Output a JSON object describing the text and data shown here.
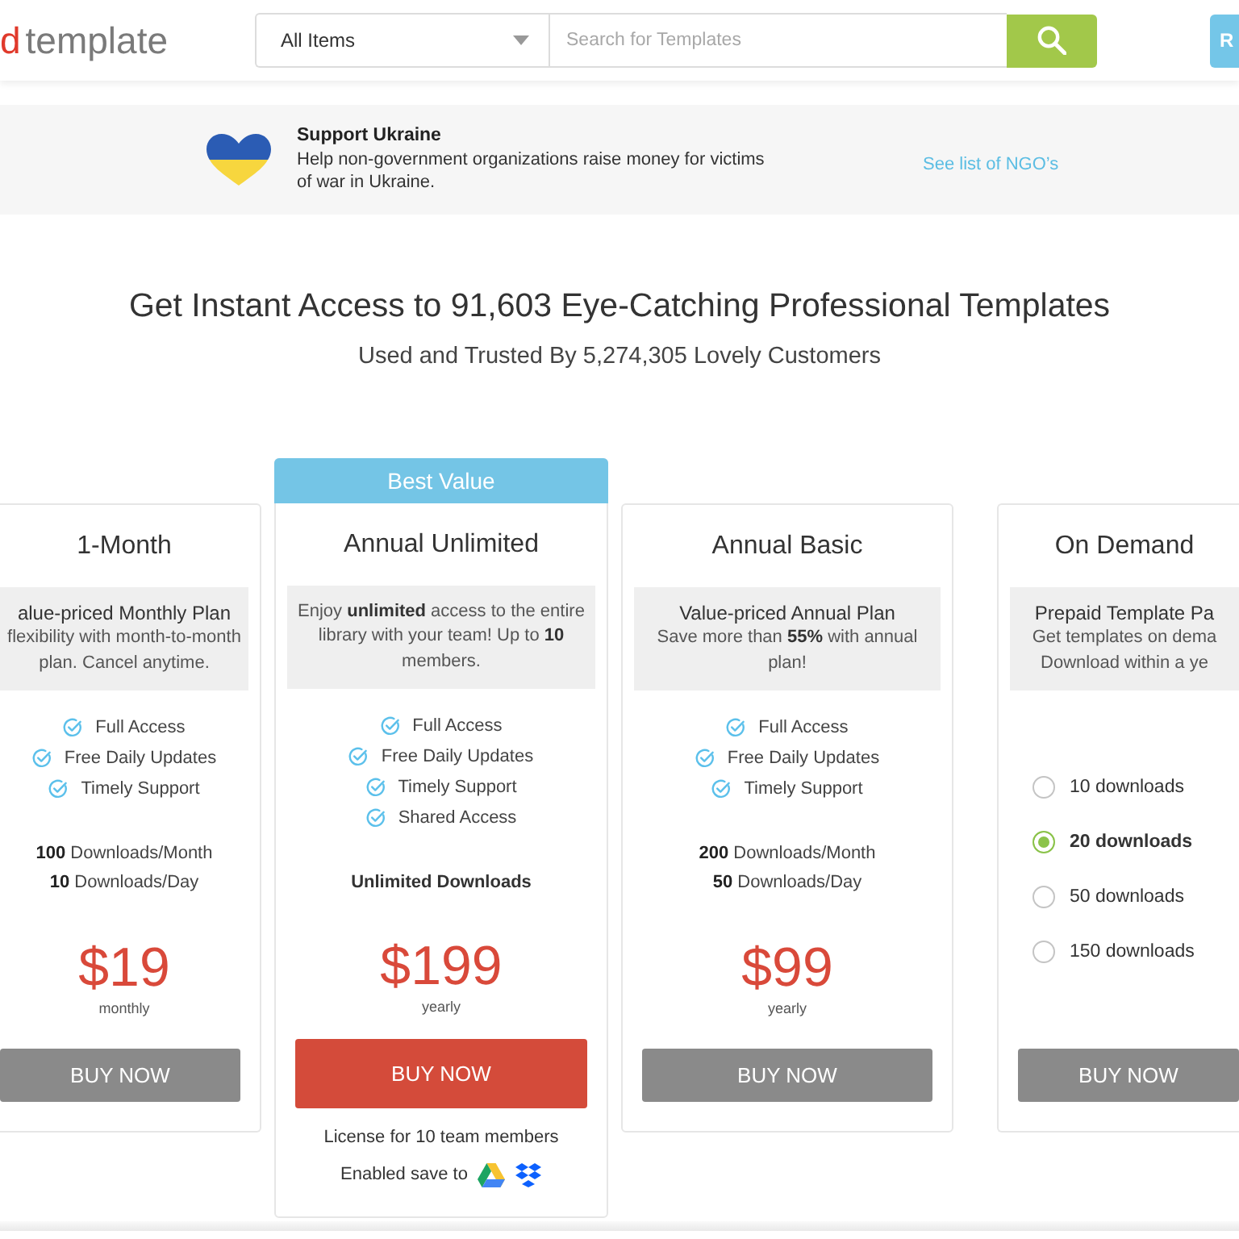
{
  "header": {
    "logo": {
      "mark": "d",
      "word": "template"
    },
    "search": {
      "category": "All Items",
      "placeholder": "Search for Templates"
    },
    "account_button": {
      "label": "R"
    }
  },
  "banner": {
    "title": "Support Ukraine",
    "text": "Help non-government organizations raise money for victims of war in Ukraine.",
    "link": "See list of NGO’s"
  },
  "hero": {
    "title": "Get Instant Access to 91,603 Eye-Catching Professional Templates",
    "subtitle": "Used and Trusted By 5,274,305 Lovely Customers"
  },
  "plans": [
    {
      "kind": "subscription",
      "name": "1-Month",
      "summary": "alue-priced Monthly Plan",
      "description": [
        "flexibility with month-to-month",
        "plan. Cancel anytime."
      ],
      "features": [
        "Full Access",
        "Free Daily Updates",
        "Timely Support"
      ],
      "downloads": [
        "**100** Downloads/Month",
        "**10** Downloads/Day"
      ],
      "price": "$19",
      "period": "monthly",
      "button": {
        "label": "BUY NOW",
        "primary": false
      }
    },
    {
      "kind": "subscription",
      "badge": "Best Value",
      "name": "Annual Unlimited",
      "description": [
        "Enjoy **unlimited** access to the entire library with your team! Up to **10** members."
      ],
      "features": [
        "Full Access",
        "Free Daily Updates",
        "Timely Support",
        "Shared Access"
      ],
      "downloads_total": "Unlimited Downloads",
      "price": "$199",
      "period": "yearly",
      "button": {
        "label": "BUY NOW",
        "primary": true
      },
      "license": "License for 10 team members",
      "save_to": "Enabled save to"
    },
    {
      "kind": "subscription",
      "name": "Annual Basic",
      "summary": "Value-priced Annual Plan",
      "description": [
        "Save more than **55%** with annual plan!"
      ],
      "features": [
        "Full Access",
        "Free Daily Updates",
        "Timely Support"
      ],
      "downloads": [
        "**200** Downloads/Month",
        "**50** Downloads/Day"
      ],
      "price": "$99",
      "period": "yearly",
      "button": {
        "label": "BUY NOW",
        "primary": false
      }
    },
    {
      "kind": "pack",
      "name": "On Demand",
      "summary": "Prepaid Template Pa",
      "description": [
        "Get templates on dema",
        "Download within a ye"
      ],
      "options": [
        {
          "label": "10 downloads",
          "selected": false
        },
        {
          "label": "20 downloads",
          "selected": true
        },
        {
          "label": "50 downloads",
          "selected": false
        },
        {
          "label": "150 downloads",
          "selected": false
        }
      ],
      "button": {
        "label": "BUY NOW",
        "primary": false
      }
    }
  ]
}
